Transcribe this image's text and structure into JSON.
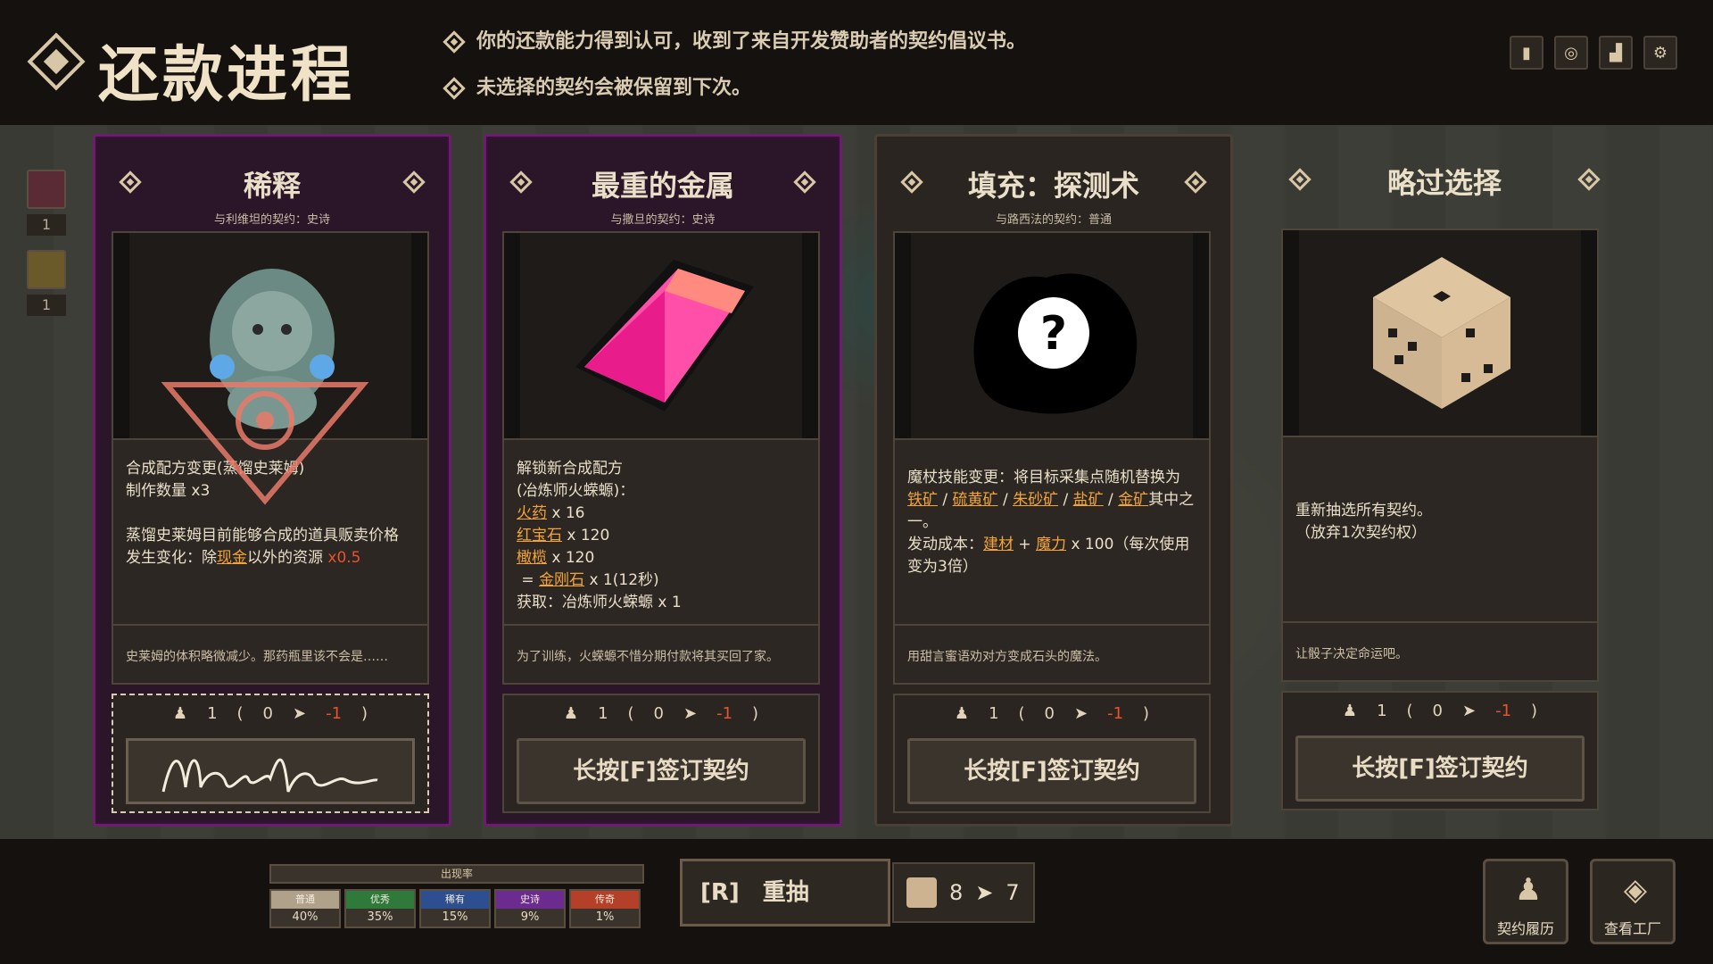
{
  "header": {
    "title": "还款进程",
    "notices": [
      "你的还款能力得到认可，收到了来自开发赞助者的契约倡议书。",
      "未选择的契约会被保留到下次。"
    ]
  },
  "top_icons": [
    "help-book-icon",
    "target-icon",
    "stats-chart-icon",
    "gear-icon"
  ],
  "side_slots": [
    {
      "icon": "meat-icon",
      "count": "1"
    },
    {
      "icon": "beehive-icon",
      "count": "1"
    }
  ],
  "cards": [
    {
      "name": "稀释",
      "subtitle": "与利维坦的契约：史诗",
      "art": "slime-girl-illustration",
      "desc": [
        {
          "text": "合成配方变更(蒸馏史莱姆)"
        },
        {
          "text": "制作数量 x3"
        },
        {
          "text": ""
        },
        {
          "text": "蒸馏史莱姆目前能够合成的道具贩卖价格"
        },
        {
          "text": "发生变化：除"
        },
        {
          "text": "现金",
          "hl": true
        },
        {
          "text": "以外的资源"
        },
        {
          "text": "x0.5",
          "red": true
        }
      ],
      "flavor": "史莱姆的体积略微减少。那药瓶里该不会是……",
      "cost": {
        "sign": "1",
        "a": "0",
        "b": "-1"
      },
      "signature": "Momoko",
      "signed": true
    },
    {
      "name": "最重的金属",
      "subtitle": "与撒旦的契约：史诗",
      "art": "ruby-ingot",
      "desc_lines": [
        "解锁新合成配方",
        "(冶炼师火蝾螈)："
      ],
      "ingredients": [
        {
          "name": "火药",
          "qty": "x 16"
        },
        {
          "name": "红宝石",
          "qty": "x 120"
        },
        {
          "name": "橄榄",
          "qty": "x 120"
        }
      ],
      "result": {
        "name": "金刚石",
        "qty": "x 1(12秒)"
      },
      "obtain": "获取：冶炼师火蝾螈 x 1",
      "flavor": "为了训练，火蝾螈不惜分期付款将其买回了家。",
      "cost": {
        "sign": "1",
        "a": "0",
        "b": "-1"
      },
      "button": "长按[F]签订契约"
    },
    {
      "name": "填充：探测术",
      "subtitle": "与路西法的契约：普通",
      "art": "mystery-rock",
      "desc_intro": "魔杖技能变更：将目标采集点随机替换为",
      "ores": [
        "铁矿",
        "硫黄矿",
        "朱砂矿",
        "盐矿",
        "金矿"
      ],
      "ore_tail": "其中之一。",
      "cost_line": {
        "prefix": "发动成本：",
        "a": "建材",
        "plus": "+",
        "b": "魔力",
        "suffix": "x 100（每次使用变为3倍）"
      },
      "flavor": "用甜言蜜语劝对方变成石头的魔法。",
      "cost": {
        "sign": "1",
        "a": "0",
        "b": "-1"
      },
      "button": "长按[F]签订契约"
    },
    {
      "name": "略过选择",
      "subtitle": "",
      "art": "dice",
      "desc_lines": [
        "重新抽选所有契约。",
        "（放弃1次契约权）"
      ],
      "flavor": "让骰子决定命运吧。",
      "cost": {
        "sign": "1",
        "a": "0",
        "b": "-1"
      },
      "button": "长按[F]签订契约"
    }
  ],
  "rates": {
    "title": "出现率",
    "items": [
      {
        "label": "普通",
        "value": "40%",
        "color": "#b0a18a"
      },
      {
        "label": "优秀",
        "value": "35%",
        "color": "#2f7a3a"
      },
      {
        "label": "稀有",
        "value": "15%",
        "color": "#2e4f8f"
      },
      {
        "label": "史诗",
        "value": "9%",
        "color": "#6b2b8f"
      },
      {
        "label": "传奇",
        "value": "1%",
        "color": "#b5402a"
      }
    ]
  },
  "reroll": {
    "label": "[R]　重抽",
    "from": "8",
    "to": "7"
  },
  "buttons": {
    "history": "契约履历",
    "factory": "查看工厂"
  }
}
